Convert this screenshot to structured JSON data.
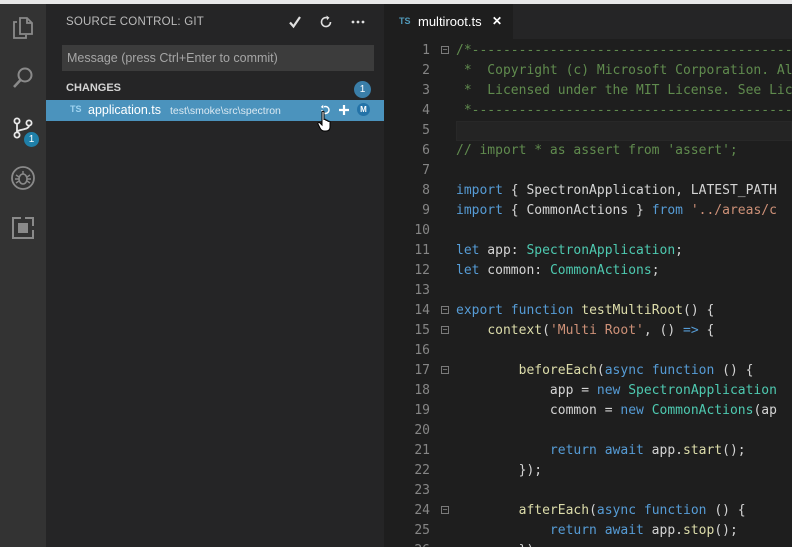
{
  "colors": {
    "keyword": "#569cd6",
    "type": "#4ec9b0",
    "string": "#ce9178",
    "comment": "#608b4e",
    "function": "#dcdcaa",
    "text": "#d4d4d4",
    "accent": "#4b93bd"
  },
  "activity_bar": {
    "source_control_badge": "1"
  },
  "sidebar": {
    "title": "SOURCE CONTROL: GIT",
    "commit_icon": "check-icon",
    "refresh_icon": "refresh-icon",
    "more_icon": "ellipsis-icon",
    "message_placeholder": "Message (press Ctrl+Enter to commit)",
    "group_title": "CHANGES",
    "group_count": "1",
    "change": {
      "badge": "TS",
      "file": "application.ts",
      "path": "test\\smoke\\src\\spectron",
      "status": "M"
    }
  },
  "editor": {
    "tab": {
      "badge": "TS",
      "name": "multiroot.ts",
      "close": "✕"
    },
    "lines": [
      {
        "n": "1",
        "fold": true,
        "tokens": [
          [
            "/*---------------------------------------------------------------------------------------------",
            "c"
          ]
        ]
      },
      {
        "n": "2",
        "tokens": [
          [
            " *  Copyright (c) Microsoft Corporation. All rights reserved.",
            "c"
          ]
        ]
      },
      {
        "n": "3",
        "tokens": [
          [
            " *  Licensed under the MIT License. See License.txt in the project root",
            "c"
          ]
        ]
      },
      {
        "n": "4",
        "tokens": [
          [
            " *--------------------------------------------------------------------------------------------*/",
            "c"
          ]
        ]
      },
      {
        "n": "5",
        "current": true,
        "tokens": []
      },
      {
        "n": "6",
        "tokens": [
          [
            "// import * as assert from 'assert';",
            "c"
          ]
        ]
      },
      {
        "n": "7",
        "tokens": []
      },
      {
        "n": "8",
        "tokens": [
          [
            "import",
            "k"
          ],
          [
            " { SpectronApplication, LATEST_PATH",
            "t"
          ]
        ]
      },
      {
        "n": "9",
        "tokens": [
          [
            "import",
            "k"
          ],
          [
            " { CommonActions } ",
            "t"
          ],
          [
            "from",
            "k"
          ],
          [
            " ",
            "t"
          ],
          [
            "'../areas/c",
            "s"
          ]
        ]
      },
      {
        "n": "10",
        "tokens": []
      },
      {
        "n": "11",
        "tokens": [
          [
            "let",
            "k"
          ],
          [
            " app: ",
            "t"
          ],
          [
            "SpectronApplication",
            "y"
          ],
          [
            ";",
            "t"
          ]
        ]
      },
      {
        "n": "12",
        "tokens": [
          [
            "let",
            "k"
          ],
          [
            " common: ",
            "t"
          ],
          [
            "CommonActions",
            "y"
          ],
          [
            ";",
            "t"
          ]
        ]
      },
      {
        "n": "13",
        "tokens": []
      },
      {
        "n": "14",
        "fold": true,
        "tokens": [
          [
            "export",
            "k"
          ],
          [
            " ",
            "t"
          ],
          [
            "function",
            "k"
          ],
          [
            " ",
            "t"
          ],
          [
            "testMultiRoot",
            "f"
          ],
          [
            "() {",
            "t"
          ]
        ]
      },
      {
        "n": "15",
        "fold": true,
        "tokens": [
          [
            "    ",
            "t"
          ],
          [
            "context",
            "f"
          ],
          [
            "(",
            "t"
          ],
          [
            "'Multi Root'",
            "s"
          ],
          [
            ", () ",
            "t"
          ],
          [
            "=>",
            "k"
          ],
          [
            " {",
            "t"
          ]
        ]
      },
      {
        "n": "16",
        "tokens": []
      },
      {
        "n": "17",
        "fold": true,
        "tokens": [
          [
            "        ",
            "t"
          ],
          [
            "beforeEach",
            "f"
          ],
          [
            "(",
            "t"
          ],
          [
            "async",
            "k"
          ],
          [
            " ",
            "t"
          ],
          [
            "function",
            "k"
          ],
          [
            " () {",
            "t"
          ]
        ]
      },
      {
        "n": "18",
        "tokens": [
          [
            "            app = ",
            "t"
          ],
          [
            "new",
            "k"
          ],
          [
            " ",
            "t"
          ],
          [
            "SpectronApplication",
            "y"
          ]
        ]
      },
      {
        "n": "19",
        "tokens": [
          [
            "            common = ",
            "t"
          ],
          [
            "new",
            "k"
          ],
          [
            " ",
            "t"
          ],
          [
            "CommonActions",
            "y"
          ],
          [
            "(ap",
            "t"
          ]
        ]
      },
      {
        "n": "20",
        "tokens": []
      },
      {
        "n": "21",
        "tokens": [
          [
            "            ",
            "t"
          ],
          [
            "return",
            "k"
          ],
          [
            " ",
            "t"
          ],
          [
            "await",
            "k"
          ],
          [
            " app.",
            "t"
          ],
          [
            "start",
            "f"
          ],
          [
            "();",
            "t"
          ]
        ]
      },
      {
        "n": "22",
        "tokens": [
          [
            "        });",
            "t"
          ]
        ]
      },
      {
        "n": "23",
        "tokens": []
      },
      {
        "n": "24",
        "fold": true,
        "tokens": [
          [
            "        ",
            "t"
          ],
          [
            "afterEach",
            "f"
          ],
          [
            "(",
            "t"
          ],
          [
            "async",
            "k"
          ],
          [
            " ",
            "t"
          ],
          [
            "function",
            "k"
          ],
          [
            " () {",
            "t"
          ]
        ]
      },
      {
        "n": "25",
        "tokens": [
          [
            "            ",
            "t"
          ],
          [
            "return",
            "k"
          ],
          [
            " ",
            "t"
          ],
          [
            "await",
            "k"
          ],
          [
            " app.",
            "t"
          ],
          [
            "stop",
            "f"
          ],
          [
            "();",
            "t"
          ]
        ]
      },
      {
        "n": "26",
        "tokens": [
          [
            "        });",
            "t"
          ]
        ]
      }
    ]
  }
}
